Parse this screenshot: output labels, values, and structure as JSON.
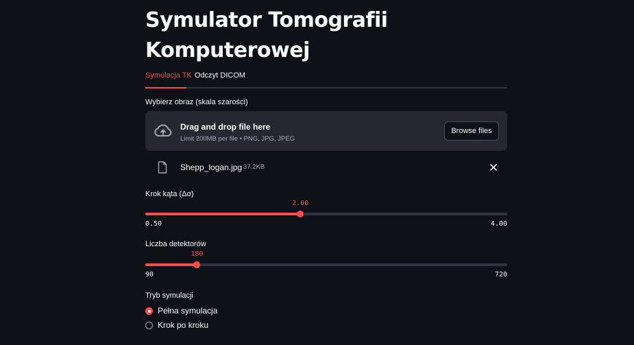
{
  "page": {
    "title_line1": "Symulator Tomografii",
    "title_line2": "Komputerowej"
  },
  "tabs": [
    {
      "label": "Symulacja TK",
      "active": true
    },
    {
      "label": "Odczyt DICOM",
      "active": false
    }
  ],
  "uploader": {
    "label": "Wybierz obraz (skala szarości)",
    "drop_text": "Drag and drop file here",
    "limit_text": "Limit 200MB per file • PNG, JPG, JPEG",
    "browse_label": "Browse files",
    "icon": "cloud-upload-icon",
    "file": {
      "name": "Shepp_logan.jpg",
      "size": "37.2KB",
      "icon": "file-icon"
    }
  },
  "sliders": {
    "angle": {
      "label": "Krok kąta (Δα)",
      "value": 2.0,
      "value_label": "2.00",
      "min": 0.5,
      "max": 4.0,
      "min_label": "0.50",
      "max_label": "4.00"
    },
    "detectors": {
      "label": "Liczba detektorów",
      "value": 180,
      "value_label": "180",
      "min": 90,
      "max": 720,
      "min_label": "90",
      "max_label": "720"
    }
  },
  "mode": {
    "label": "Tryb symulacji",
    "options": [
      {
        "label": "Pełna symulacja",
        "checked": true
      },
      {
        "label": "Krok po kroku",
        "checked": false
      }
    ]
  },
  "colors": {
    "accent": "#ff4b4b",
    "background": "#0e1117",
    "panel": "#262730",
    "track": "#31333f"
  }
}
